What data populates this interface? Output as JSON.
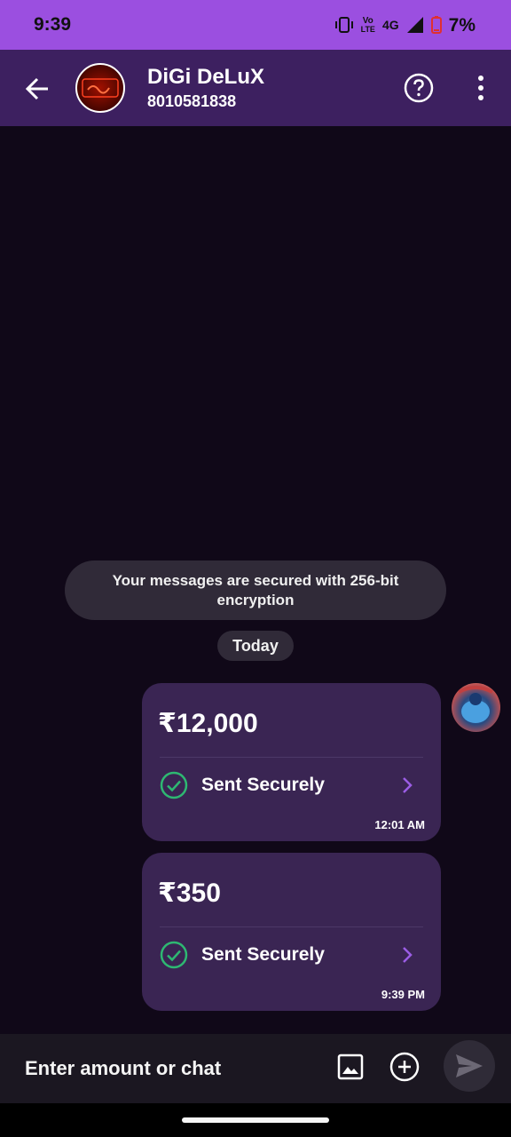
{
  "status_bar": {
    "time": "9:39",
    "network_top": "Vo",
    "network_bottom": "LTE",
    "network_type": "4G",
    "battery": "7%"
  },
  "header": {
    "contact_name": "DiGi DeLuX",
    "contact_phone": "8010581838"
  },
  "chat": {
    "encryption_notice": "Your messages are secured with 256-bit encryption",
    "date_label": "Today",
    "payments": [
      {
        "amount": "₹12,000",
        "status": "Sent Securely",
        "time": "12:01 AM"
      },
      {
        "amount": "₹350",
        "status": "Sent Securely",
        "time": "9:39 PM"
      }
    ]
  },
  "input_bar": {
    "placeholder": "Enter amount or chat"
  },
  "colors": {
    "status_bar": "#9b4fe0",
    "header": "#3d2060",
    "background": "#100818",
    "bubble": "#3a2553",
    "check_green": "#2eb872",
    "chevron_purple": "#9b5de5"
  }
}
